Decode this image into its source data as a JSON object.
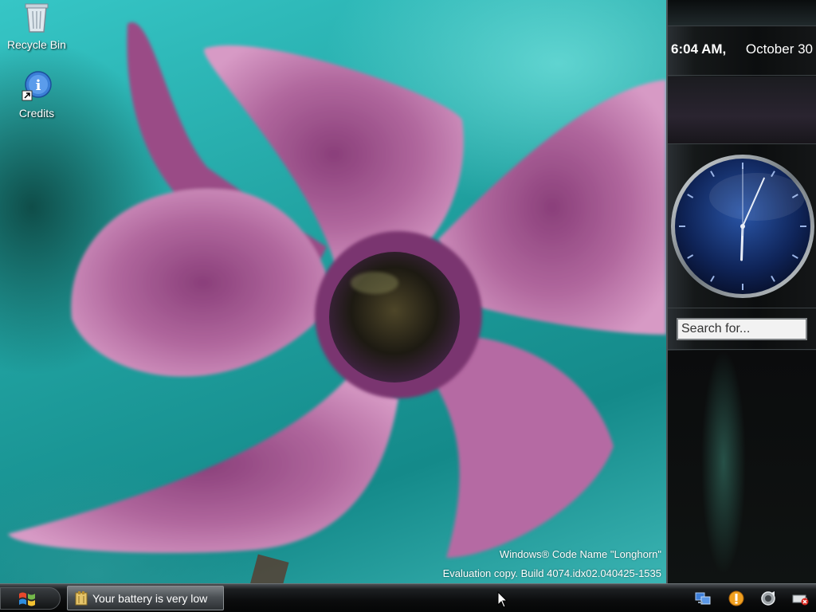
{
  "desktop": {
    "icons": [
      {
        "label": "Recycle Bin",
        "icon": "recycle-bin-icon"
      },
      {
        "label": "Credits",
        "icon": "info-shortcut-icon"
      }
    ],
    "watermark": {
      "line1": "Windows® Code Name \"Longhorn\"",
      "line2": "Evaluation copy. Build 4074.idx02.040425-1535"
    }
  },
  "sidebar": {
    "time": "6:04 AM,",
    "date": "October 30",
    "clock": {
      "hour": 6,
      "minute": 4,
      "second": 0
    },
    "search": {
      "placeholder": "Search for..."
    }
  },
  "taskbar": {
    "start_icon": "windows-flag-icon",
    "task_item": {
      "label": "Your battery is very low",
      "icon": "battery-warning-icon"
    },
    "tray_icons": [
      "network-icon",
      "security-alert-icon",
      "volume-icon",
      "power-icon"
    ]
  },
  "colors": {
    "wallpaper_teal": "#1f9f9e",
    "petal_pink": "#b0679d",
    "sidebar_dark": "#0c0e0f",
    "clock_blue": "#1d3f86"
  }
}
